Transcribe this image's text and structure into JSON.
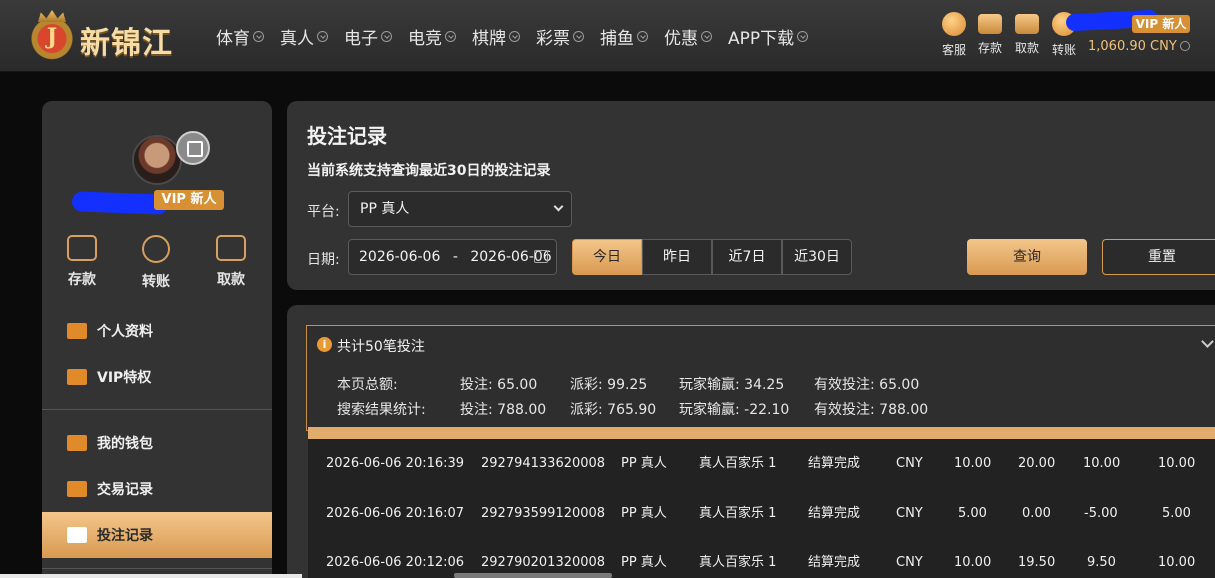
{
  "header": {
    "logo_text": "新锦江",
    "logo_letter": "J",
    "nav": [
      "体育",
      "真人",
      "电子",
      "电竞",
      "棋牌",
      "彩票",
      "捕鱼",
      "优惠",
      "APP下载"
    ],
    "tools": [
      "客服",
      "存款",
      "取款",
      "转账"
    ],
    "vip_badge": "VIP 新人",
    "balance": "1,060.90 CNY"
  },
  "sidebar": {
    "vip_badge": "VIP 新人",
    "quick": [
      "存款",
      "转账",
      "取款"
    ],
    "menu": [
      "个人资料",
      "VIP特权",
      "我的钱包",
      "交易记录",
      "投注记录"
    ],
    "active": "投注记录"
  },
  "filter": {
    "title": "投注记录",
    "notice": "当前系统支持查询最近30日的投注记录",
    "platform_label": "平台:",
    "platform_value": "PP 真人",
    "date_label": "日期:",
    "date_start": "2026-06-06",
    "date_sep": "-",
    "date_end": "2026-06-06",
    "ranges": [
      "今日",
      "昨日",
      "近7日",
      "近30日"
    ],
    "query_label": "查询",
    "reset_label": "重置"
  },
  "summary": {
    "title": "共计50笔投注",
    "page_label": "本页总额:",
    "search_label": "搜索结果统计:",
    "page": {
      "bet": "投注: 65.00",
      "payout": "派彩: 99.25",
      "winloss": "玩家输赢: 34.25",
      "valid": "有效投注: 65.00"
    },
    "search": {
      "bet": "投注: 788.00",
      "payout": "派彩: 765.90",
      "winloss": "玩家输赢: -22.10",
      "valid": "有效投注: 788.00"
    }
  },
  "rows": [
    [
      "2026-06-06 20:16:39",
      "292794133620008",
      "PP 真人",
      "真人百家乐 1",
      "结算完成",
      "CNY",
      "10.00",
      "20.00",
      "10.00",
      "10.00"
    ],
    [
      "2026-06-06 20:16:07",
      "292793599120008",
      "PP 真人",
      "真人百家乐 1",
      "结算完成",
      "CNY",
      "5.00",
      "0.00",
      "-5.00",
      "5.00"
    ],
    [
      "2026-06-06 20:12:06",
      "292790201320008",
      "PP 真人",
      "真人百家乐 1",
      "结算完成",
      "CNY",
      "10.00",
      "19.50",
      "9.50",
      "10.00"
    ]
  ],
  "colors": {
    "accent": "#d99a52",
    "accent_light": "#f3c68a",
    "panel": "#333333",
    "table_bg": "#222222",
    "redaction": "#1430ff"
  }
}
